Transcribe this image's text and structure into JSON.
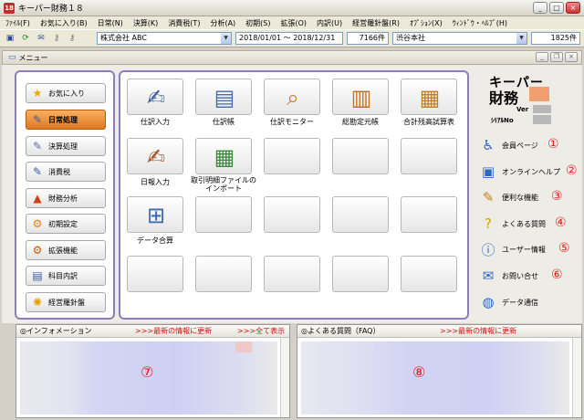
{
  "window": {
    "title": "キーパー財務１８",
    "app_icon": "18"
  },
  "menu": [
    "ﾌｧｲﾙ(F)",
    "お気に入り(B)",
    "日常(N)",
    "決算(K)",
    "消費税(T)",
    "分析(A)",
    "初期(S)",
    "拡張(O)",
    "内訳(U)",
    "経営羅針盤(R)",
    "ｵﾌﾟｼｮﾝ(X)",
    "ｳｨﾝﾄﾞｳ・ﾍﾙﾌﾟ(H)"
  ],
  "toolbar": {
    "company": "株式会社 ABC",
    "period": "2018/01/01 ～ 2018/12/31",
    "count1": "7166件",
    "branch": "渋谷本社",
    "count2": "1825件"
  },
  "child_window": {
    "title": "メニュー"
  },
  "left_nav": [
    {
      "label": "お気に入り",
      "icon": "star-icon"
    },
    {
      "label": "日常処理",
      "icon": "journal-icon",
      "active": true
    },
    {
      "label": "決算処理",
      "icon": "settlement-icon"
    },
    {
      "label": "消費税",
      "icon": "tax-icon"
    },
    {
      "label": "財務分析",
      "icon": "chart-icon"
    },
    {
      "label": "初期設定",
      "icon": "gear-icon"
    },
    {
      "label": "拡張機能",
      "icon": "gears-icon"
    },
    {
      "label": "科目内訳",
      "icon": "ledger-icon"
    },
    {
      "label": "経営羅針盤",
      "icon": "compass-icon"
    }
  ],
  "tiles": [
    {
      "label": "仕訳入力",
      "icon": "journal-entry-icon"
    },
    {
      "label": "仕訳帳",
      "icon": "journal-book-icon"
    },
    {
      "label": "仕訳モニター",
      "icon": "monitor-icon"
    },
    {
      "label": "総勘定元帳",
      "icon": "general-ledger-icon"
    },
    {
      "label": "合計残高試算表",
      "icon": "trial-balance-icon"
    },
    {
      "label": "日報入力",
      "icon": "daily-report-icon"
    },
    {
      "label": "取引明細ファイルの",
      "label2": "インポート",
      "icon": "import-icon"
    },
    {
      "label": "データ合算",
      "icon": "data-merge-icon"
    }
  ],
  "brand": {
    "line1": "キーパー",
    "line2": "財務",
    "ver_label": "Ver",
    "serial_label": "ｼﾘｱﾙNo"
  },
  "right_links": [
    {
      "label": "会員ページ",
      "num": "①",
      "icon": "member-icon"
    },
    {
      "label": "オンラインヘルプ",
      "num": "②",
      "icon": "help-icon"
    },
    {
      "label": "便利な機能",
      "num": "③",
      "icon": "tools-icon"
    },
    {
      "label": "よくある質問",
      "num": "④",
      "icon": "faq-icon"
    },
    {
      "label": "ユーザー情報",
      "num": "⑤",
      "icon": "info-icon"
    },
    {
      "label": "お問い合せ",
      "num": "⑥",
      "icon": "contact-icon"
    },
    {
      "label": "データ通信",
      "num": "",
      "icon": "globe-icon"
    }
  ],
  "info_panel": {
    "title": "◎インフォメーション",
    "update": ">>>最新の情報に更新",
    "show_all": ">>>全て表示",
    "num": "⑦"
  },
  "faq_panel": {
    "title": "◎よくある質問（FAQ）",
    "update": ">>>最新の情報に更新",
    "num": "⑧"
  }
}
